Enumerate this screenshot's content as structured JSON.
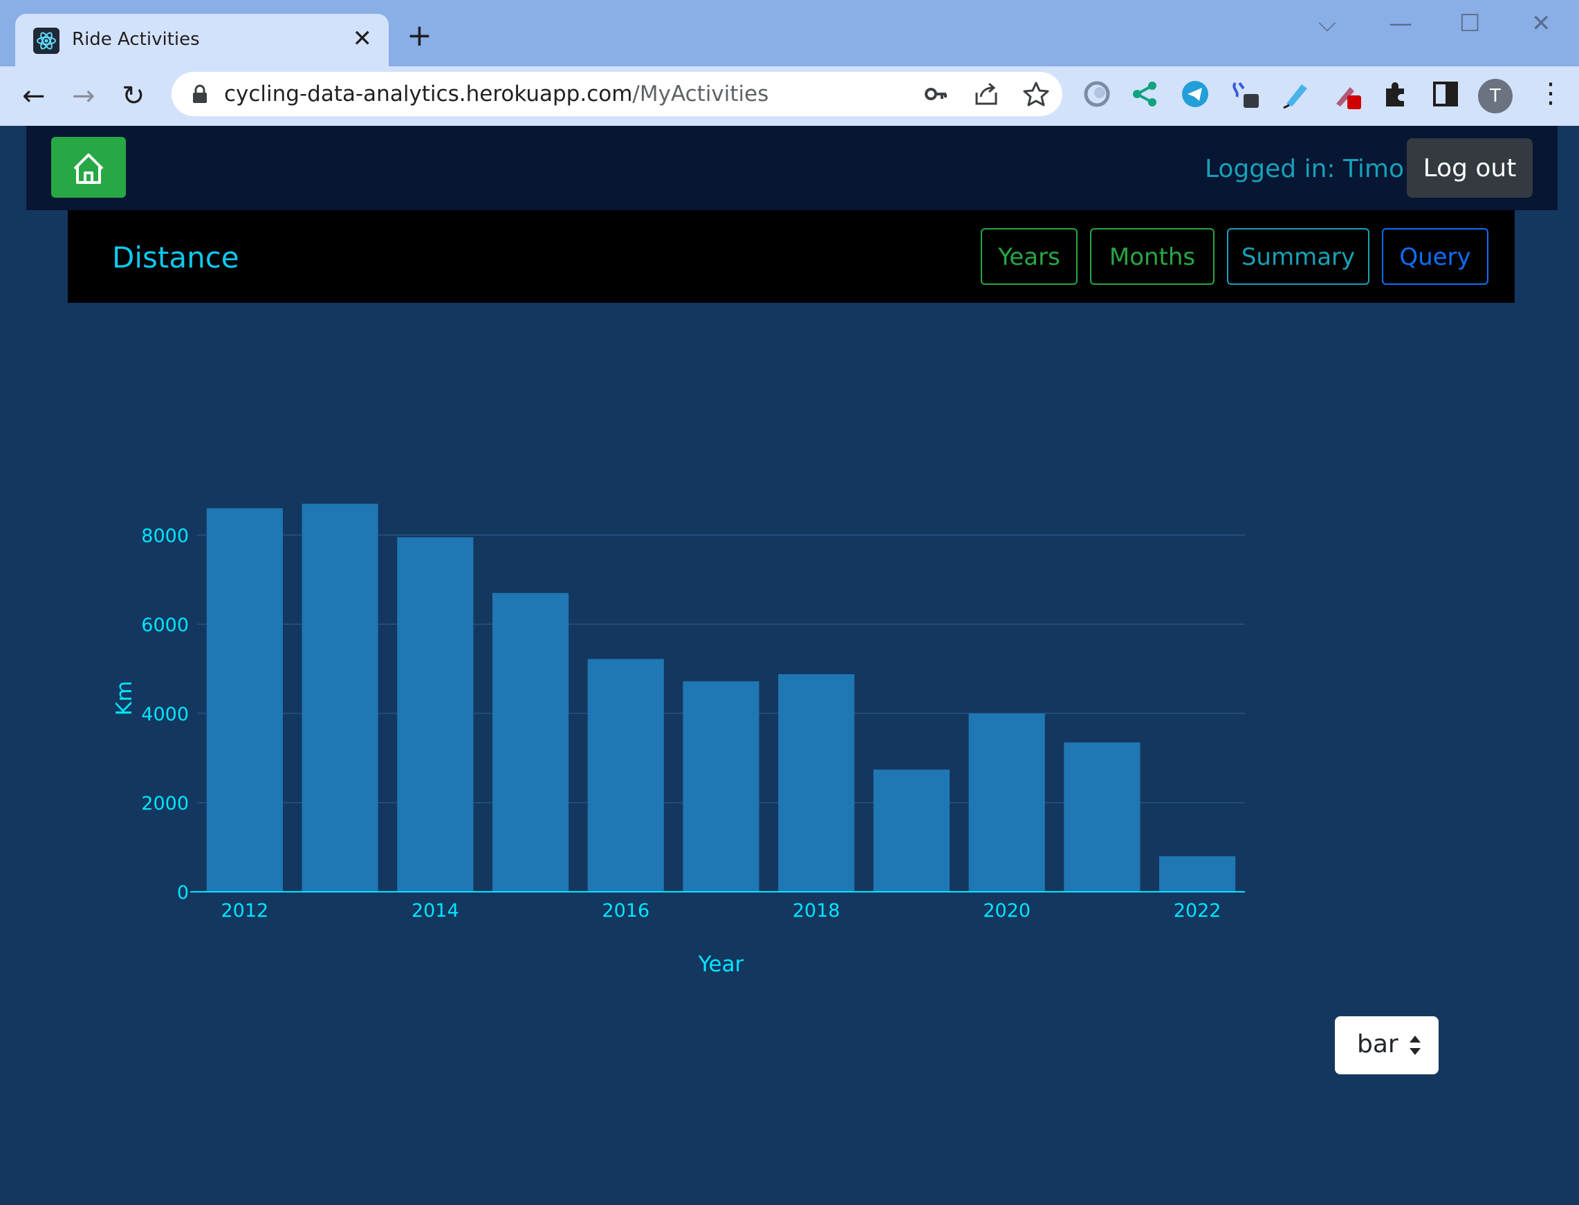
{
  "browser": {
    "tab_title": "Ride Activities",
    "tab_close": "✕",
    "new_tab": "+",
    "url_host": "cycling-data-analytics.herokuapp.com",
    "url_path": "/MyActivities",
    "avatar_letter": "T",
    "window_controls": {
      "dropdown": "⌵",
      "minimize": "—",
      "maximize": "☐",
      "close": "✕"
    },
    "nav": {
      "back": "←",
      "forward": "→",
      "reload": "↻",
      "menu": "⋮"
    }
  },
  "navbar": {
    "logged_in": "Logged in: Timo",
    "logout": "Log out"
  },
  "subnav": {
    "title": "Distance",
    "buttons": {
      "years": "Years",
      "months": "Months",
      "summary": "Summary",
      "query": "Query"
    }
  },
  "chart_type_select": {
    "value": "bar"
  },
  "colors": {
    "bar": "#1f77b4",
    "accent": "#00e5ff",
    "page_bg": "#14375f",
    "success": "#28a745"
  },
  "chart_data": {
    "type": "bar",
    "categories": [
      "2012",
      "2013",
      "2014",
      "2015",
      "2016",
      "2017",
      "2018",
      "2019",
      "2020",
      "2021",
      "2022"
    ],
    "values": [
      8600,
      8700,
      7950,
      6700,
      5220,
      4720,
      4880,
      2740,
      4000,
      3350,
      800
    ],
    "xlabel": "Year",
    "ylabel": "Km",
    "ylim": [
      0,
      9300
    ],
    "yticks": [
      0,
      2000,
      4000,
      6000,
      8000
    ],
    "xticks": [
      "2012",
      "2014",
      "2016",
      "2018",
      "2020",
      "2022"
    ],
    "grid": true
  }
}
